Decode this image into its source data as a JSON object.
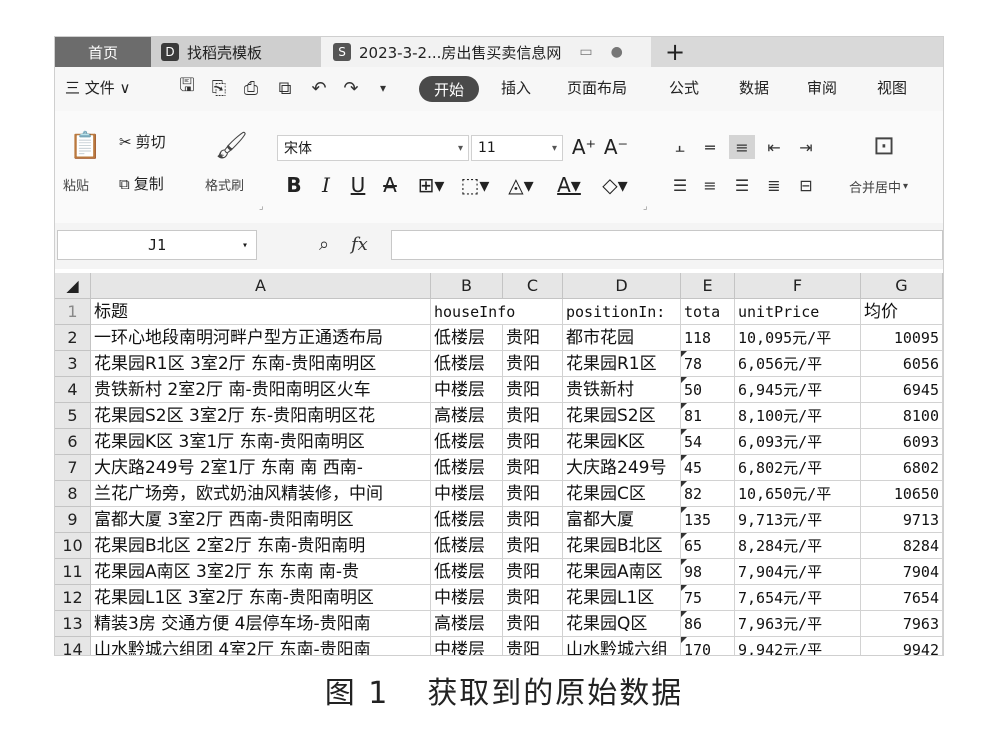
{
  "tabs": {
    "home": "首页",
    "template": "找稻壳模板",
    "template_icon": "D",
    "document": "2023-3-2...房出售买卖信息网",
    "document_icon": "S",
    "add": "+"
  },
  "menu": {
    "file": "三 文件 ∨",
    "tabs": [
      "开始",
      "插入",
      "页面布局",
      "公式",
      "数据",
      "审阅",
      "视图"
    ],
    "active": "开始"
  },
  "ribbon": {
    "paste": "粘贴",
    "cut": "剪切",
    "copy": "复制",
    "format_painter": "格式刷",
    "font_name": "宋体",
    "font_size": "11",
    "merge_center": "合并居中"
  },
  "formula_bar": {
    "cell_ref": "J1",
    "zoom_icon": "search-icon",
    "fx": "fx",
    "formula": ""
  },
  "sheet": {
    "columns": [
      "A",
      "B",
      "C",
      "D",
      "E",
      "F",
      "G"
    ],
    "header_row": [
      "标题",
      "houseInfo",
      "positionIn:",
      "tota",
      "unitPrice",
      "均价"
    ],
    "rows": [
      {
        "n": "2",
        "a": "一环心地段南明河畔户型方正通透布局",
        "b": "低楼层",
        "c": "贵阳",
        "d": "都市花园",
        "e": "118",
        "f": "10,095元/平",
        "g": "10095"
      },
      {
        "n": "3",
        "a": "花果园R1区 3室2厅 东南-贵阳南明区",
        "b": "低楼层",
        "c": "贵阳",
        "d": "花果园R1区",
        "e": "78",
        "f": "6,056元/平",
        "g": "6056"
      },
      {
        "n": "4",
        "a": "贵铁新村 2室2厅 南-贵阳南明区火车",
        "b": "中楼层",
        "c": "贵阳",
        "d": "贵铁新村",
        "e": "50",
        "f": "6,945元/平",
        "g": "6945"
      },
      {
        "n": "5",
        "a": "花果园S2区 3室2厅 东-贵阳南明区花",
        "b": "高楼层",
        "c": "贵阳",
        "d": "花果园S2区",
        "e": "81",
        "f": "8,100元/平",
        "g": "8100"
      },
      {
        "n": "6",
        "a": "花果园K区 3室1厅 东南-贵阳南明区",
        "b": "低楼层",
        "c": "贵阳",
        "d": "花果园K区",
        "e": "54",
        "f": "6,093元/平",
        "g": "6093"
      },
      {
        "n": "7",
        "a": "大庆路249号 2室1厅 东南 南 西南-",
        "b": "低楼层",
        "c": "贵阳",
        "d": "大庆路249号",
        "e": "45",
        "f": "6,802元/平",
        "g": "6802"
      },
      {
        "n": "8",
        "a": "兰花广场旁，欧式奶油风精装修，中间",
        "b": "中楼层",
        "c": "贵阳",
        "d": "花果园C区",
        "e": "82",
        "f": "10,650元/平",
        "g": "10650"
      },
      {
        "n": "9",
        "a": "富都大厦 3室2厅 西南-贵阳南明区",
        "b": "低楼层",
        "c": "贵阳",
        "d": "富都大厦",
        "e": "135",
        "f": "9,713元/平",
        "g": "9713"
      },
      {
        "n": "10",
        "a": "花果园B北区 2室2厅 东南-贵阳南明",
        "b": "低楼层",
        "c": "贵阳",
        "d": "花果园B北区",
        "e": "65",
        "f": "8,284元/平",
        "g": "8284"
      },
      {
        "n": "11",
        "a": "花果园A南区 3室2厅 东 东南 南-贵",
        "b": "低楼层",
        "c": "贵阳",
        "d": "花果园A南区",
        "e": "98",
        "f": "7,904元/平",
        "g": "7904"
      },
      {
        "n": "12",
        "a": "花果园L1区 3室2厅 东南-贵阳南明区",
        "b": "中楼层",
        "c": "贵阳",
        "d": "花果园L1区",
        "e": "75",
        "f": "7,654元/平",
        "g": "7654"
      },
      {
        "n": "13",
        "a": "精装3房 交通方便 4层停车场-贵阳南",
        "b": "高楼层",
        "c": "贵阳",
        "d": "花果园Q区",
        "e": "86",
        "f": "7,963元/平",
        "g": "7963"
      },
      {
        "n": "14",
        "a": "山水黔城六组团 4室2厅 东南-贵阳南",
        "b": "中楼层",
        "c": "贵阳",
        "d": "山水黔城六组",
        "e": "170",
        "f": "9,942元/平",
        "g": "9942"
      }
    ]
  },
  "caption": {
    "label": "图 1",
    "text": "获取到的原始数据"
  }
}
